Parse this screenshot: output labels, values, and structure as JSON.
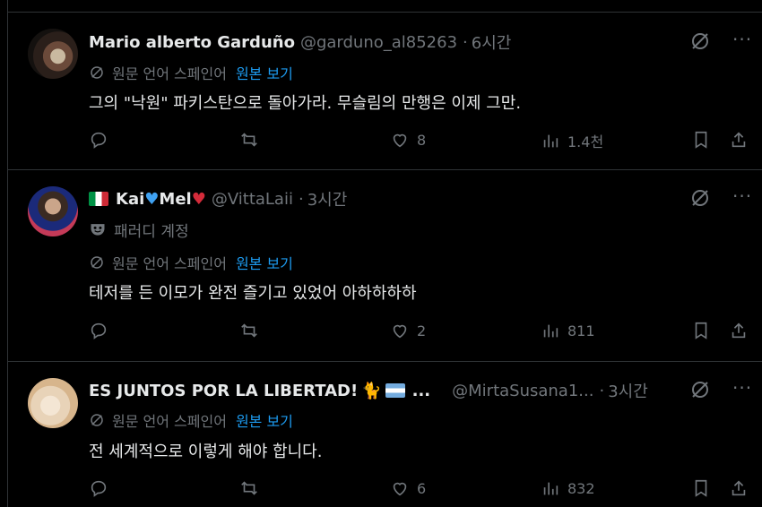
{
  "tweets": [
    {
      "name": "Mario alberto Garduño",
      "handle": "@garduno_al85263",
      "time": "6시간",
      "translate_label": "원문 언어 스페인어",
      "show_original": "원본 보기",
      "text": "그의 \"낙원\" 파키스탄으로 돌아가라. 무슬림의 만행은 이제 그만.",
      "likes": "8",
      "views": "1.4천"
    },
    {
      "name_part1": "Kai",
      "name_part2": "Mel",
      "handle": "@VittaLaii",
      "time": "3시간",
      "parody_label": "패러디 계정",
      "translate_label": "원문 언어 스페인어",
      "show_original": "원본 보기",
      "text": "테저를 든 이모가 완전 즐기고 있었어 아하하하하",
      "likes": "2",
      "views": "811"
    },
    {
      "name": "ES JUNTOS POR LA LIBERTAD!",
      "name_suffix": "...",
      "handle": "@MirtaSusana1...",
      "time": "3시간",
      "translate_label": "원문 언어 스페인어",
      "show_original": "원본 보기",
      "text": "전 세계적으로 이렇게 해야 합니다.",
      "likes": "6",
      "views": "832"
    }
  ],
  "separator": "·",
  "icons": [
    "grok-icon",
    "more-icon",
    "translate-icon",
    "reply-icon",
    "retweet-icon",
    "like-icon",
    "views-icon",
    "bookmark-icon",
    "share-icon",
    "mask-icon"
  ],
  "colors": {
    "background": "#000000",
    "text": "#e7e9ea",
    "muted": "#71767b",
    "link": "#1d9bf0",
    "border": "#2f3336"
  }
}
